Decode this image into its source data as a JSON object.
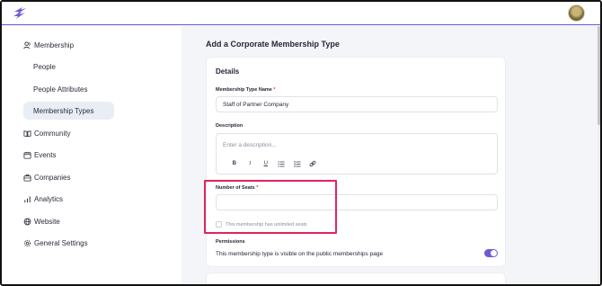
{
  "app": {
    "logo_icon": "lightning-logo-icon",
    "accent_color": "#6b5bd6",
    "avatar_icon": "user-avatar"
  },
  "sidebar": {
    "items": [
      {
        "label": "Membership",
        "icon": "users-icon"
      },
      {
        "label": "People"
      },
      {
        "label": "People Attributes"
      },
      {
        "label": "Membership Types",
        "active": true
      },
      {
        "label": "Community",
        "icon": "book-open-icon"
      },
      {
        "label": "Events",
        "icon": "calendar-icon"
      },
      {
        "label": "Companies",
        "icon": "briefcase-icon"
      },
      {
        "label": "Analytics",
        "icon": "bar-chart-icon"
      },
      {
        "label": "Website",
        "icon": "globe-icon"
      },
      {
        "label": "General Settings",
        "icon": "gear-icon"
      }
    ]
  },
  "main": {
    "page_title": "Add a Corporate Membership Type",
    "details": {
      "section_title": "Details",
      "name_label": "Membership Type Name",
      "required_mark": "*",
      "name_value": "Staff of Partner Company",
      "description_label": "Description",
      "description_placeholder": "Enter a description...",
      "toolbar": {
        "bold": "B",
        "italic": "I",
        "underline": "U",
        "numbered_list": "ordered-list-icon",
        "bulleted_list": "bullet-list-icon",
        "link": "link-icon"
      },
      "seats_label": "Number of Seats",
      "seats_value": "",
      "unlimited_label": "This membership has unlimited seats",
      "unlimited_checked": false,
      "permissions_label": "Permissions",
      "permissions_text": "This membership type is visible on the public memberships page",
      "permissions_on": true
    },
    "highlight_color": "#e0245e"
  }
}
